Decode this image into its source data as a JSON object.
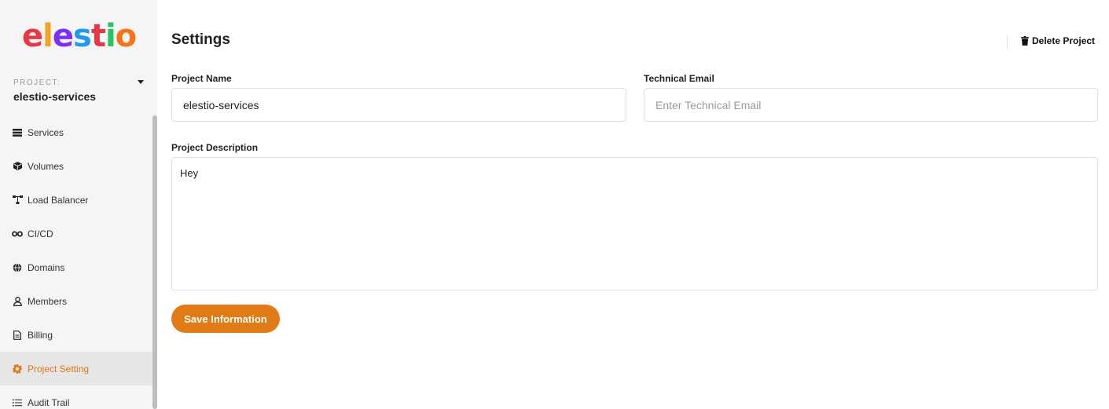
{
  "brand": {
    "logo_text": "elestio",
    "logo_colors": [
      "#e63946",
      "#f4a31e",
      "#7b2ff7",
      "#1d9bf0",
      "#e63946",
      "#22c55e",
      "#f97316"
    ]
  },
  "project": {
    "label": "PROJECT:",
    "name": "elestio-services"
  },
  "sidebar": {
    "items": [
      {
        "label": "Services",
        "icon": "server-icon"
      },
      {
        "label": "Volumes",
        "icon": "cube-icon"
      },
      {
        "label": "Load Balancer",
        "icon": "network-icon"
      },
      {
        "label": "CI/CD",
        "icon": "infinity-icon"
      },
      {
        "label": "Domains",
        "icon": "globe-icon"
      },
      {
        "label": "Members",
        "icon": "user-icon"
      },
      {
        "label": "Billing",
        "icon": "document-icon"
      },
      {
        "label": "Project Setting",
        "icon": "gear-icon",
        "active": true
      },
      {
        "label": "Audit Trail",
        "icon": "list-icon"
      }
    ]
  },
  "main": {
    "title": "Settings",
    "delete_label": "Delete Project",
    "project_name_label": "Project Name",
    "project_name_value": "elestio-services",
    "technical_email_label": "Technical Email",
    "technical_email_value": "",
    "technical_email_placeholder": "Enter Technical Email",
    "description_label": "Project Description",
    "description_value": "Hey",
    "save_label": "Save Information"
  },
  "colors": {
    "accent": "#e07b16",
    "sidebar_bg": "#f5f5f5",
    "active_bg": "#e6e6e6"
  }
}
